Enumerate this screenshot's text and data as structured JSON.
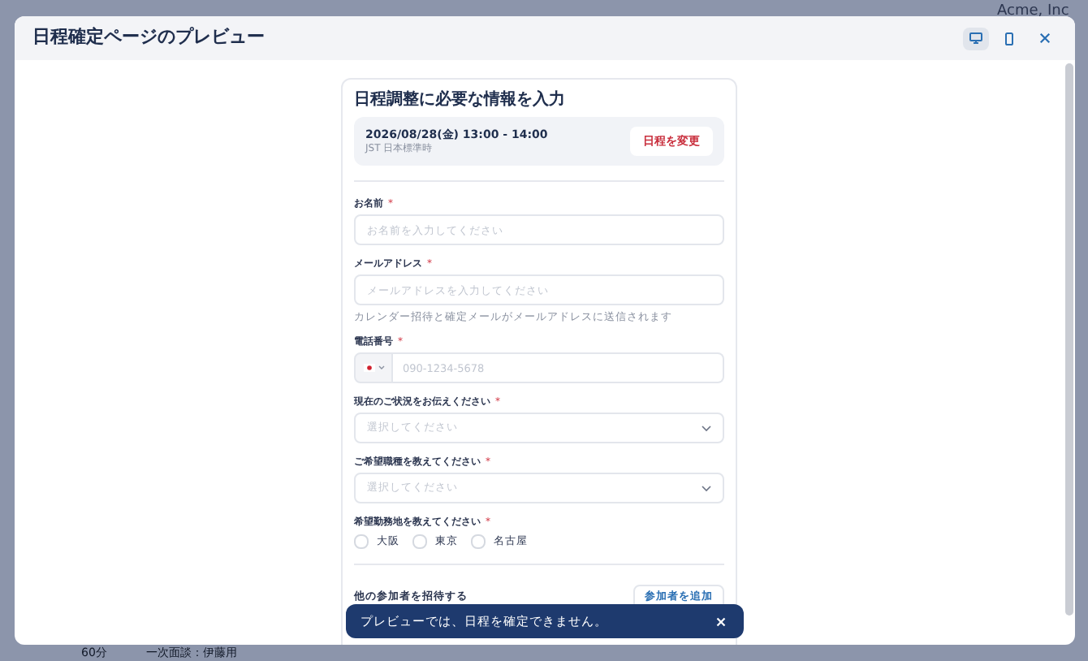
{
  "background": {
    "org_name": "Acme, Inc",
    "bottom_row": {
      "duration": "60分",
      "title": "一次面談：伊藤用"
    }
  },
  "modal": {
    "title": "日程確定ページのプレビュー",
    "view_buttons": [
      {
        "kind": "desktop",
        "selected": true
      },
      {
        "kind": "mobile",
        "selected": false
      }
    ],
    "form": {
      "heading": "日程調整に必要な情報を入力",
      "schedule": {
        "datetime": "2026/08/28(金) 13:00 - 14:00",
        "timezone": "JST 日本標準時",
        "change_button": "日程を変更"
      },
      "fields": [
        {
          "kind": "text",
          "label": "お名前",
          "required_mark": "*",
          "placeholder": "お名前を入力してください"
        },
        {
          "kind": "text",
          "label": "メールアドレス",
          "required_mark": "*",
          "placeholder": "メールアドレスを入力してください",
          "helper": "カレンダー招待と確定メールがメールアドレスに送信されます"
        },
        {
          "kind": "phone",
          "label": "電話番号",
          "required_mark": "*",
          "placeholder": "090-1234-5678"
        },
        {
          "kind": "select",
          "label": "現在のご状況をお伝えください",
          "required_mark": "*",
          "placeholder": "選択してください"
        },
        {
          "kind": "select",
          "label": "ご希望職種を教えてください",
          "required_mark": "*",
          "placeholder": "選択してください"
        },
        {
          "kind": "checkboxes",
          "label": "希望勤務地を教えてください",
          "required_mark": "*",
          "options": [
            {
              "label": "大阪",
              "checked": false
            },
            {
              "label": "東京",
              "checked": false
            },
            {
              "label": "名古屋",
              "checked": false
            }
          ]
        }
      ],
      "invite": {
        "label": "他の参加者を招待する",
        "button": "参加者を追加"
      }
    },
    "toast": {
      "message": "プレビューでは、日程を確定できません。"
    }
  }
}
